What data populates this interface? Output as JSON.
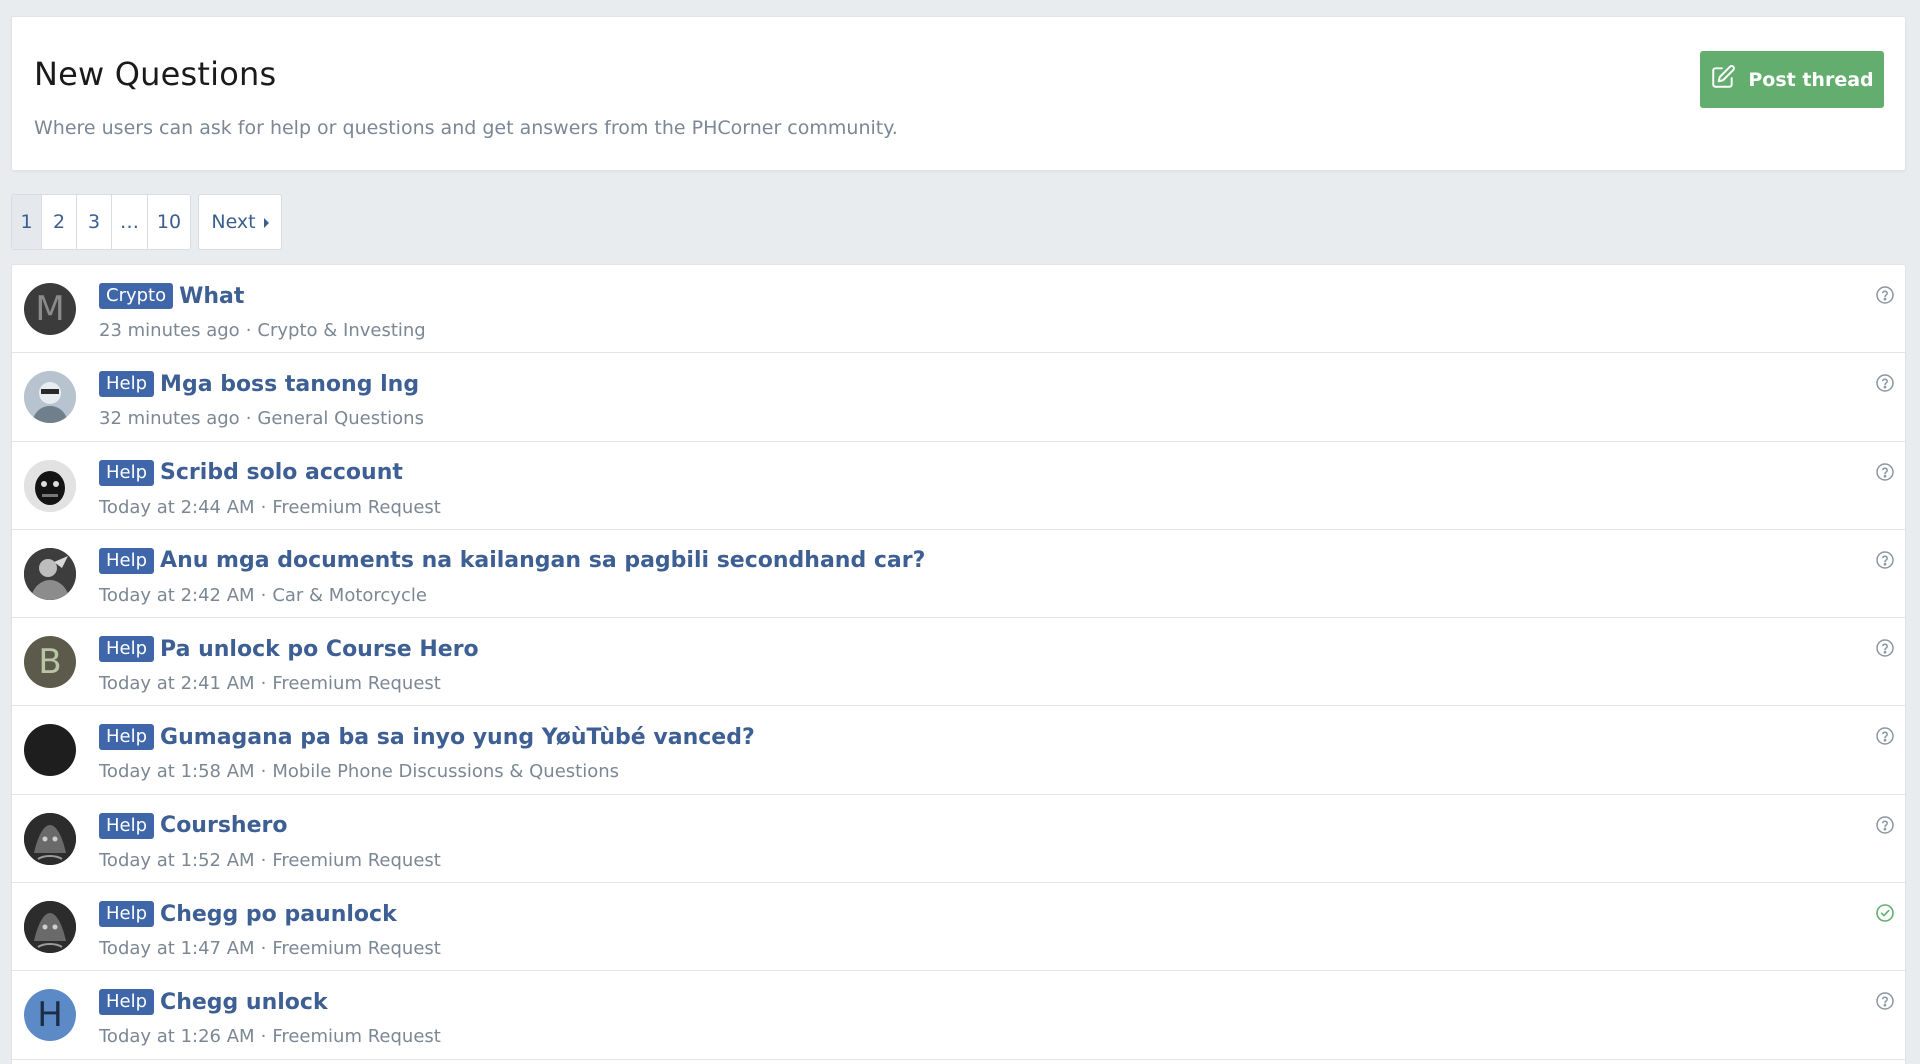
{
  "header": {
    "title": "New Questions",
    "description": "Where users can ask for help or questions and get answers from the PHCorner community.",
    "post_thread_label": "Post thread",
    "post_thread_color": "#63ae6e"
  },
  "pagination": {
    "pages": [
      "1",
      "2",
      "3",
      "…",
      "10"
    ],
    "current": "1",
    "next_label": "Next"
  },
  "threads": [
    {
      "prefix": "Crypto",
      "title": "What",
      "time": "23 minutes ago",
      "forum": "Crypto & Investing",
      "avatar_letter": "M",
      "avatar_bg": "#3b3b3b",
      "avatar_fg": "#8a8a8a",
      "status_icon": "question-icon"
    },
    {
      "prefix": "Help",
      "title": "Mga boss tanong lng",
      "time": "32 minutes ago",
      "forum": "General Questions",
      "avatar_letter": "",
      "avatar_bg": "#c9d3dc",
      "avatar_fg": "#333",
      "status_icon": "question-icon"
    },
    {
      "prefix": "Help",
      "title": "Scribd solo account",
      "time": "Today at 2:44 AM",
      "forum": "Freemium Request",
      "avatar_letter": "",
      "avatar_bg": "#d9d9d9",
      "avatar_fg": "#111",
      "status_icon": "question-icon"
    },
    {
      "prefix": "Help",
      "title": "Anu mga documents na kailangan sa pagbili secondhand car?",
      "time": "Today at 2:42 AM",
      "forum": "Car & Motorcycle",
      "avatar_letter": "",
      "avatar_bg": "#4a4a4a",
      "avatar_fg": "#ddd",
      "status_icon": "question-icon"
    },
    {
      "prefix": "Help",
      "title": "Pa unlock po Course Hero",
      "time": "Today at 2:41 AM",
      "forum": "Freemium Request",
      "avatar_letter": "B",
      "avatar_bg": "#5c5a4a",
      "avatar_fg": "#b8c6a5",
      "status_icon": "question-icon"
    },
    {
      "prefix": "Help",
      "title": "Gumagana pa ba sa inyo yung YøùTùbé vanced?",
      "time": "Today at 1:58 AM",
      "forum": "Mobile Phone Discussions & Questions",
      "avatar_letter": "",
      "avatar_bg": "#1e1e1e",
      "avatar_fg": "#1e1e1e",
      "status_icon": "question-icon"
    },
    {
      "prefix": "Help",
      "title": "Courshero",
      "time": "Today at 1:52 AM",
      "forum": "Freemium Request",
      "avatar_letter": "",
      "avatar_bg": "#3a3a3a",
      "avatar_fg": "#999",
      "status_icon": "question-icon"
    },
    {
      "prefix": "Help",
      "title": "Chegg po paunlock",
      "time": "Today at 1:47 AM",
      "forum": "Freemium Request",
      "avatar_letter": "",
      "avatar_bg": "#3a3a3a",
      "avatar_fg": "#999",
      "status_icon": "solved-icon"
    },
    {
      "prefix": "Help",
      "title": "Chegg unlock",
      "time": "Today at 1:26 AM",
      "forum": "Freemium Request",
      "avatar_letter": "H",
      "avatar_bg": "#5b8ac7",
      "avatar_fg": "#1c2d45",
      "status_icon": "question-icon"
    }
  ],
  "colors": {
    "prefix_badge": "#3e66a8",
    "title_link": "#3d5f94",
    "question_icon": "#8a96a3",
    "solved_icon": "#63ae6e"
  }
}
